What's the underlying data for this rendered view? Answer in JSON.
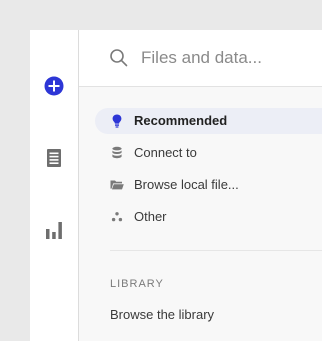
{
  "sidebar": {
    "icons": [
      "add-circle-icon",
      "document-icon",
      "bar-chart-icon"
    ],
    "accent": "#2d36d6",
    "icon_color": "#6e6e6e"
  },
  "search": {
    "placeholder": "Files and data..."
  },
  "menu": {
    "items": [
      {
        "label": "Recommended",
        "icon": "lightbulb-icon",
        "active": true
      },
      {
        "label": "Connect to",
        "icon": "database-icon",
        "active": false
      },
      {
        "label": "Browse local file...",
        "icon": "folder-open-icon",
        "active": false
      },
      {
        "label": "Other",
        "icon": "dots-icon",
        "active": false
      }
    ]
  },
  "library": {
    "heading": "LIBRARY",
    "link": "Browse the library"
  }
}
